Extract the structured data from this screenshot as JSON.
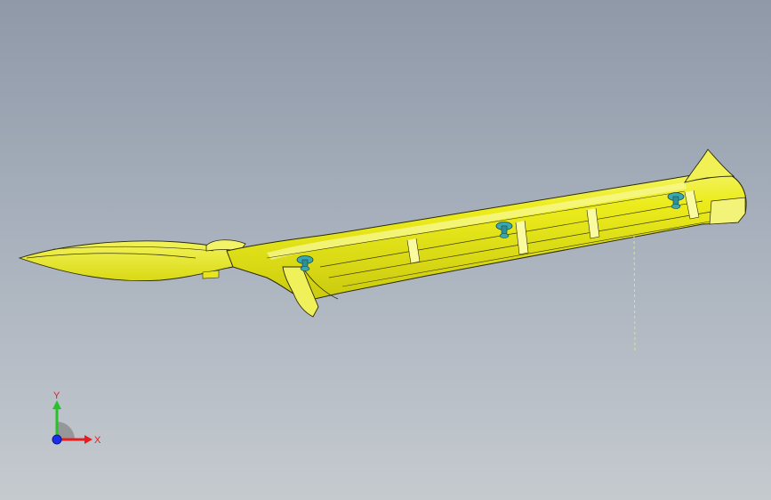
{
  "viewport": {
    "colors": {
      "part_fill": "#ecec1c",
      "part_fill_light": "#f6f67a",
      "part_fill_shadow": "#c9c914",
      "edge": "#2a2a08",
      "clip_fill": "#3aa8b0",
      "clip_edge": "#14474c",
      "center_line": "#e8e85a"
    }
  },
  "triad": {
    "y_label": "Y",
    "x_label": "X",
    "colors": {
      "x_axis": "#e81c1c",
      "y_axis": "#27c227",
      "z_axis": "#1c2fe8",
      "label": "#e81c1c",
      "arc": "#8c8c8c"
    }
  }
}
